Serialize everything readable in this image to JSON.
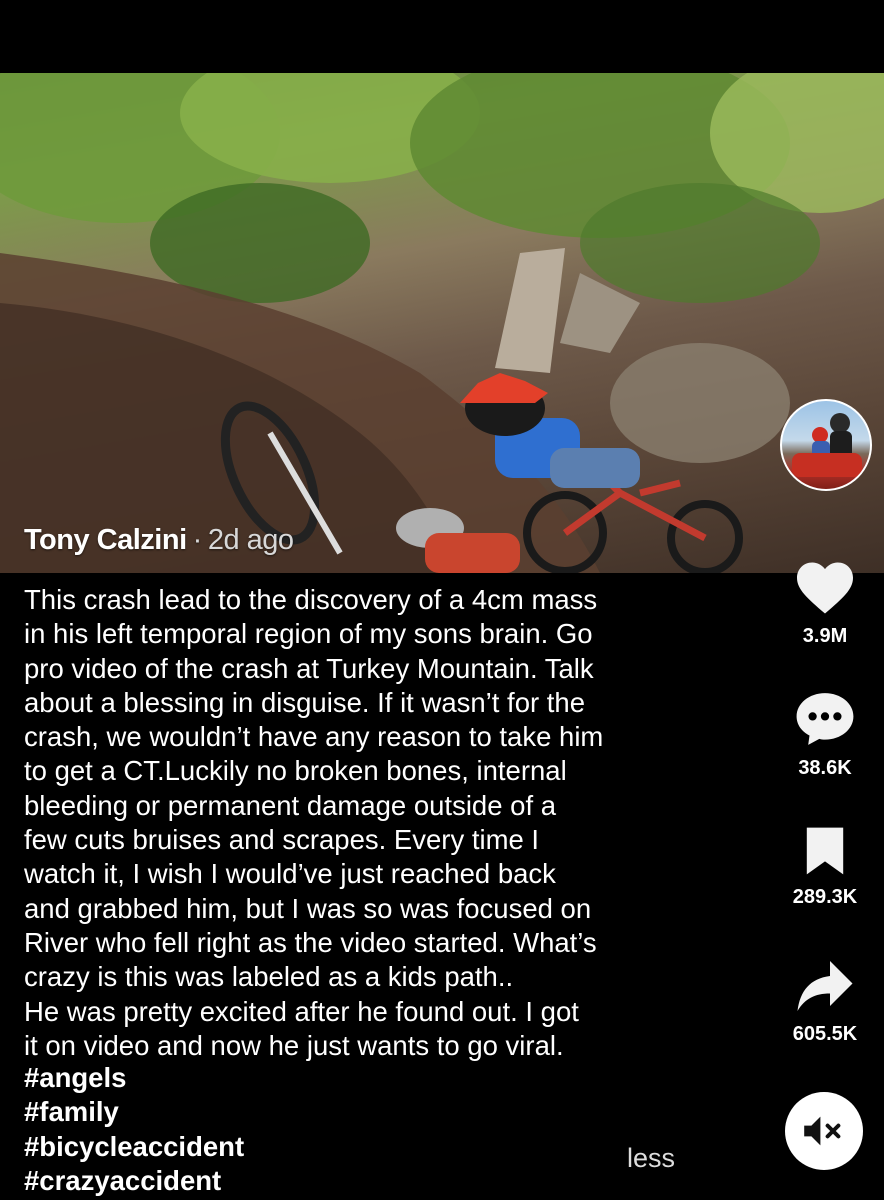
{
  "post": {
    "author": "Tony Calzini",
    "separator": "·",
    "time_ago": "2d ago",
    "caption": "This crash lead to the discovery of a 4cm mass\nin his left temporal region of my sons brain. Go\npro video of the crash at Turkey Mountain. Talk\nabout a blessing in disguise. If it wasn’t for the\ncrash, we wouldn’t have any reason to take him\nto get a CT.Luckily no broken bones, internal\nbleeding or permanent damage outside of a\nfew cuts bruises and scrapes. Every time I\nwatch it, I wish I would’ve just reached back\nand grabbed him, but I was so was focused on\nRiver who fell right as the video started. What’s\ncrazy is this was labeled as a kids path..\nHe was pretty excited after he found out. I got\nit on video and now he just wants to go viral.",
    "hashtags": [
      "#angels",
      "#family",
      "#bicycleaccident",
      "#crazyaccident"
    ],
    "less_label": "less"
  },
  "actions": {
    "like": {
      "icon": "heart-icon",
      "count": "3.9M"
    },
    "comment": {
      "icon": "comment-icon",
      "count": "38.6K"
    },
    "bookmark": {
      "icon": "bookmark-icon",
      "count": "289.3K"
    },
    "share": {
      "icon": "share-icon",
      "count": "605.5K"
    },
    "mute": {
      "icon": "speaker-muted-icon"
    }
  }
}
